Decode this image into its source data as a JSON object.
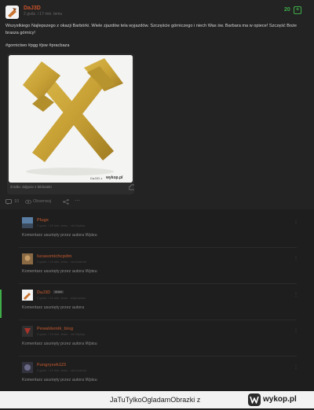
{
  "post": {
    "author": "DaJ3D",
    "meta": "2 godz. i 17 min. temu",
    "votes": "20",
    "body": "Wszystkiego Najlepszego z okazji Barbórki. Wiele zjazdów tela wyjazdów. Szczęście górniczego i niech Was św. Barbara ma w opiece! Szczęść Boże brasza górnicy!",
    "tags": "#gornictwo #pgg #jsw #pracbaza",
    "image_source": "źródło: Zdjęcie z biblioteki",
    "watermark_user": "DaJ3D z",
    "watermark_brand": "wykop.pl",
    "comment_count": "10",
    "observe_label": "Obserwuj"
  },
  "comments": [
    {
      "author": "Pluge",
      "meta": "2 godz. i 15 min. temu · via Wykop",
      "text": "Komentarz usunięty przez autora Wpisu",
      "badge": ""
    },
    {
      "author": "lucaszmichcpdm",
      "meta": "2 godz. i 14 min. temu · via Android",
      "text": "Komentarz usunięty przez autora Wpisu",
      "badge": ""
    },
    {
      "author": "DaJ3D",
      "meta": "2 godz. i 14 min. temu · edytowano",
      "text": "Komentarz usunięty przez autora",
      "badge": "Autor"
    },
    {
      "author": "Pewaldemik_biog",
      "meta": "2 godz. i 13 min. temu · via Wykop",
      "text": "Komentarz usunięty przez autora Wpisu",
      "badge": ""
    },
    {
      "author": "Fungrysek123",
      "meta": "2 godz. i 12 min. temu · via Android",
      "text": "Komentarz usunięty przez autora Wpisu",
      "badge": ""
    }
  ],
  "footer": {
    "text": "JaTuTylkoOgladamObrazki z",
    "logo_text": "wykop.pl"
  },
  "colors": {
    "accent": "#c7522a",
    "upvote": "#3fae49",
    "background": "#1c1c1c"
  },
  "icons": [
    "comment-icon",
    "eye-icon",
    "share-icon",
    "more-icon",
    "cloud-icon",
    "plus-icon",
    "kebab-menu-icon"
  ]
}
